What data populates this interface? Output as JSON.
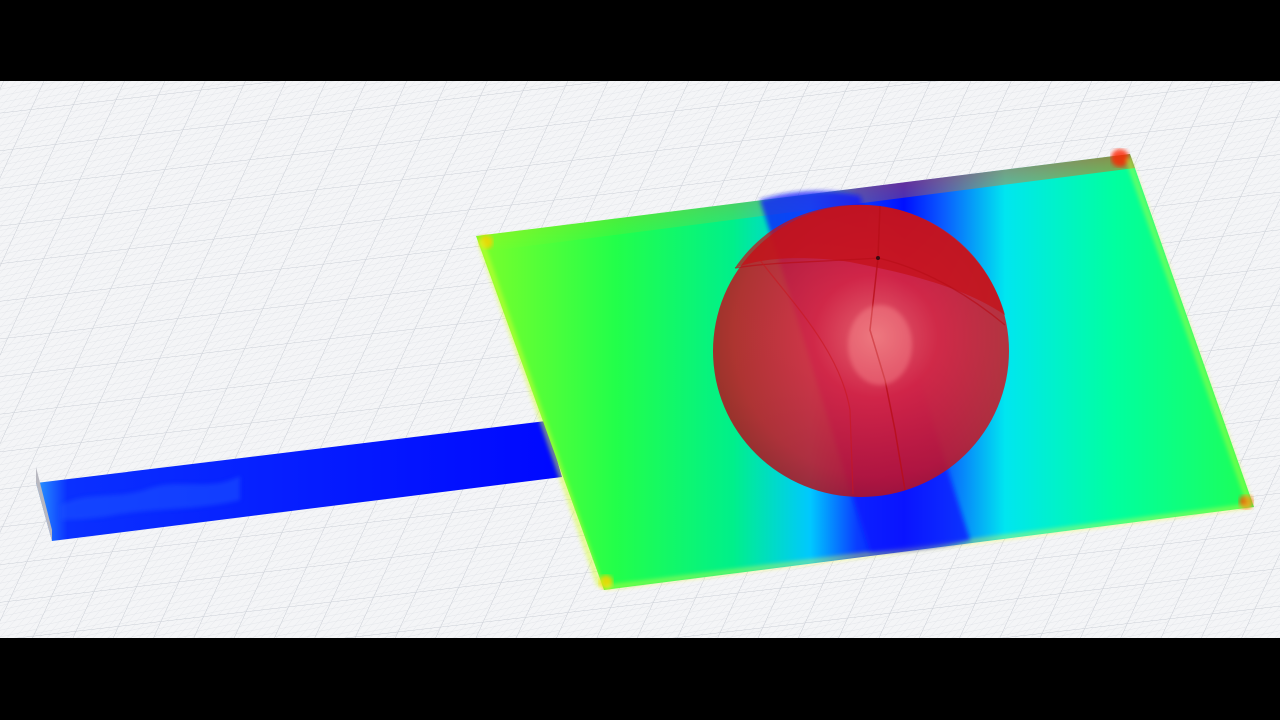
{
  "scene": {
    "letterbox_color": "#000000",
    "grid_background_color": "#f4f5f7",
    "grid_line_color": "#c9ced6",
    "feed_line_color": "#0008ff",
    "patch_color_stops": [
      "#ff1a00",
      "#ffe000",
      "#6aff2a",
      "#00ff66",
      "#00f0e0",
      "#0a7bff",
      "#0010ff"
    ],
    "radiation_pattern_color": "#e0101a",
    "objects": [
      "grid-ground-plane",
      "microstrip-feed-line",
      "patch-antenna",
      "radiation-pattern-3d"
    ]
  }
}
